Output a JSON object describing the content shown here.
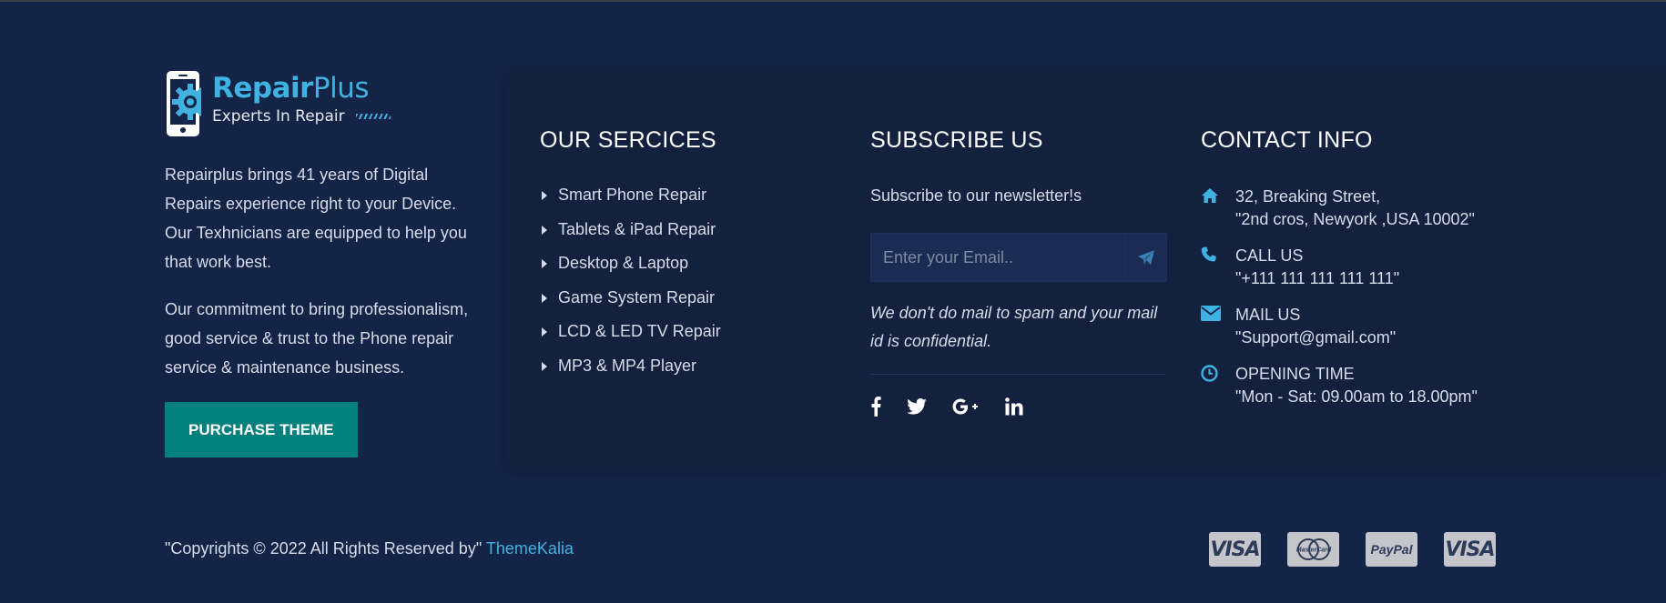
{
  "brand": {
    "name_main": "Repair",
    "name_plus": "Plus",
    "tagline": "Experts In Repair",
    "paragraph1": "Repairplus brings 41 years of Digital Repairs experience right to your Device. Our Texhnicians are equipped to help you that work best.",
    "paragraph2": "Our commitment to bring professionalism, good service & trust to the Phone repair service & maintenance business.",
    "purchase_label": "PURCHASE THEME"
  },
  "services": {
    "title": "OUR SERCICES",
    "items": [
      "Smart Phone Repair",
      "Tablets & iPad Repair",
      "Desktop & Laptop",
      "Game System Repair",
      "LCD & LED TV Repair",
      "MP3 & MP4 Player"
    ]
  },
  "subscribe": {
    "title": "SUBSCRIBE US",
    "intro": "Subscribe to our newsletter!s",
    "email_placeholder": "Enter your Email..",
    "note": "We don't do mail to spam and your mail id is confidential.",
    "socials": [
      "facebook-icon",
      "twitter-icon",
      "google-plus-icon",
      "linkedin-icon"
    ]
  },
  "contact": {
    "title": "CONTACT INFO",
    "items": [
      {
        "icon": "home-icon",
        "line1": "32, Breaking Street,",
        "line2": "\"2nd cros, Newyork ,USA 10002\""
      },
      {
        "icon": "phone-icon",
        "line1": "CALL US",
        "line2": "\"+111 111 111 111 111\""
      },
      {
        "icon": "envelope-icon",
        "line1": "MAIL US",
        "line2": "\"Support@gmail.com\""
      },
      {
        "icon": "clock-icon",
        "line1": "OPENING TIME",
        "line2": "\"Mon - Sat: 09.00am to 18.00pm\""
      }
    ]
  },
  "footer": {
    "copyright": "\"Copyrights © 2022 All Rights Reserved by\"",
    "author_link": "ThemeKalia",
    "payment_cards": [
      "VISA",
      "MasterCard",
      "PayPal",
      "VISA"
    ]
  },
  "colors": {
    "background": "#142447",
    "panel": "#13213f",
    "accent": "#3fb2e2",
    "button": "#00817e"
  }
}
